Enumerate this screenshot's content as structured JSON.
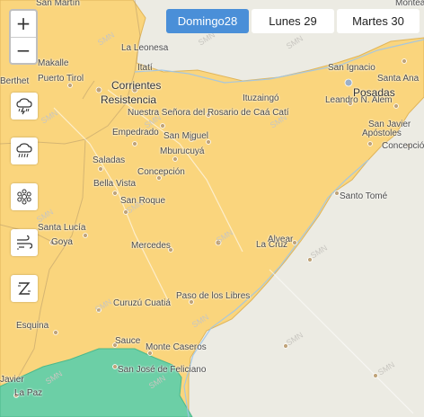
{
  "zoom": {
    "in_label": "+",
    "out_label": "−"
  },
  "tabs": [
    {
      "label": "Domingo28",
      "active": true
    },
    {
      "label": "Lunes 29",
      "active": false
    },
    {
      "label": "Martes 30",
      "active": false
    }
  ],
  "hazard_buttons": [
    {
      "icon": "rain-storm-icon"
    },
    {
      "icon": "rain-icon"
    },
    {
      "icon": "snow-icon"
    },
    {
      "icon": "wind-icon"
    },
    {
      "icon": "heat-icon"
    }
  ],
  "watermark": "SMN",
  "colors": {
    "alert_yellow": "#fad57d",
    "alert_green": "#6ccfa6",
    "land": "#ecebe3",
    "tab_active": "#4a8fd8"
  },
  "places": [
    "San Martín",
    "La Leonesa",
    "Makalle",
    "Itatí",
    "San Ignacio",
    "Monteagudo",
    "Berthet",
    "Puerto Tirol",
    "Corrientes",
    "Resistencia",
    "Itatí",
    "Ituzaingó",
    "Leandro N. Alem",
    "Posadas",
    "Santa Ana",
    "Nuestra Señora del Rosario de Caá Catí",
    "Empedrado",
    "San Miguel",
    "San Javier",
    "Apóstoles",
    "Mburucuyá",
    "Concepción",
    "Saladas",
    "Concepción",
    "Bella Vista",
    "Santo Tomé",
    "San Roque",
    "Santa Lucía",
    "Goya",
    "Mercedes",
    "Alvear",
    "La Cruz",
    "Paso de los Libres",
    "Curuzú Cuatiá",
    "Esquina",
    "Sauce",
    "Monte Caseros",
    "San José de Feliciano",
    "La Paz",
    "Javier"
  ]
}
